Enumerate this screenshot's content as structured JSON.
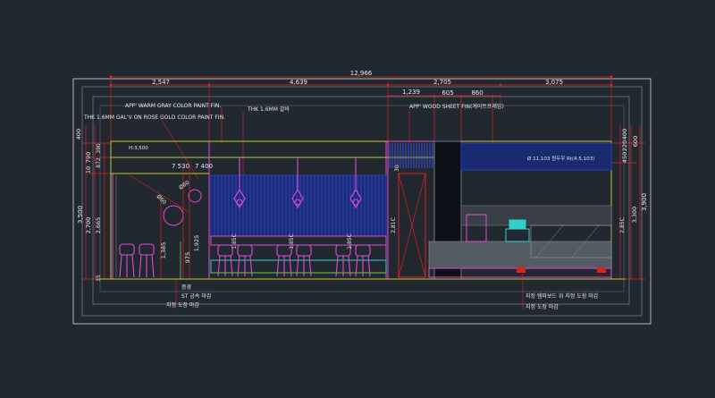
{
  "drawing": {
    "overall_dim": "12,966",
    "top_dims": [
      "2,547",
      "4,639",
      "2,705",
      "3,075"
    ],
    "sub_dims": [
      "1,239",
      "605",
      "860"
    ],
    "left_outer_dim": "3,500",
    "left_dims": [
      "400",
      "10",
      "790",
      "2,700",
      "2,665",
      "35"
    ],
    "left_small_dims": [
      "390",
      "872"
    ],
    "right_outer_dim": "3,900",
    "right_dims": [
      "400",
      "600",
      "450",
      "220",
      "3,300"
    ],
    "notes": {
      "warm_gray": "APP' WARM GRAY COLOR PAINT FIN.",
      "galv": "THK 1.6MM GAL'V ON ROSE GOLD COLOR PAINT FIN.",
      "thk16": "THK 1.6MM 갈바",
      "wood_sheet": "APP' WOOD SHEET FIN(게이트프레임)",
      "h3500": "H:3,500",
      "d530": "7 530",
      "d400": "7 400",
      "d1925": "1,925",
      "d1385": "1,385",
      "d975": "975",
      "d60a": "Ø60",
      "d60b": "Ø60",
      "c185_1": "1,85C",
      "c185_2": "1,85C",
      "c185_3": "1,85C",
      "c281": "2,81C",
      "c285": "2,85C",
      "d30": "30",
      "signage": "Ø 11,103 원두우 Rt(4.5,103)"
    },
    "bottom_notes_left": [
      "증경",
      "ST 금속 마감",
      "지정 도장 마감"
    ],
    "bottom_notes_right": [
      "지정 템파보드 위 지정 도장 마감",
      "지정 도장 마감"
    ]
  }
}
